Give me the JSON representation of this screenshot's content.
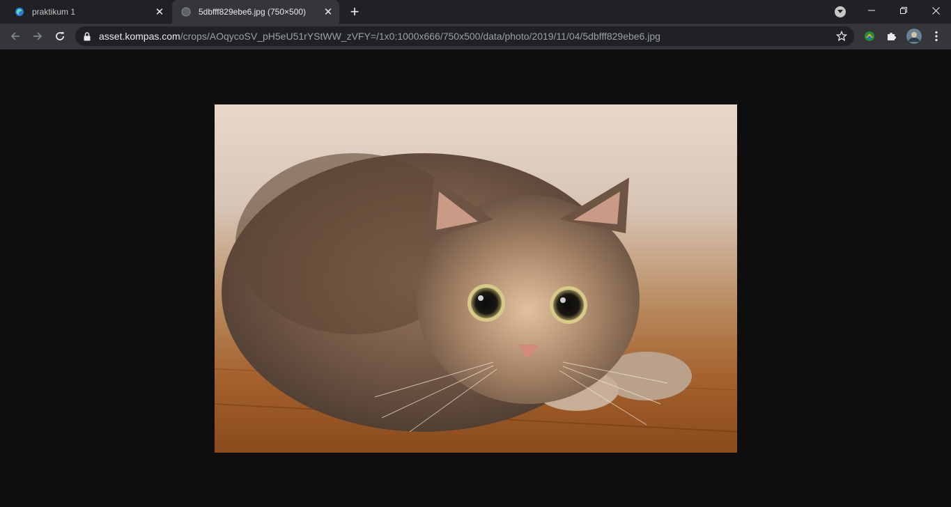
{
  "tabs": [
    {
      "title": "praktikum 1",
      "icon": "edge-logo-icon",
      "active": false
    },
    {
      "title": "5dbfff829ebe6.jpg (750×500)",
      "icon": "globe-icon",
      "active": true
    }
  ],
  "toolbar": {
    "url_host": "asset.kompas.com",
    "url_path": "/crops/AOqycoSV_pH5eU51rYStWW_zVFY=/1x0:1000x666/750x500/data/photo/2019/11/04/5dbfff829ebe6.jpg"
  },
  "colors": {
    "tabstrip_bg": "#202124",
    "toolbar_bg": "#35363a",
    "page_bg": "#0e0e0e"
  }
}
